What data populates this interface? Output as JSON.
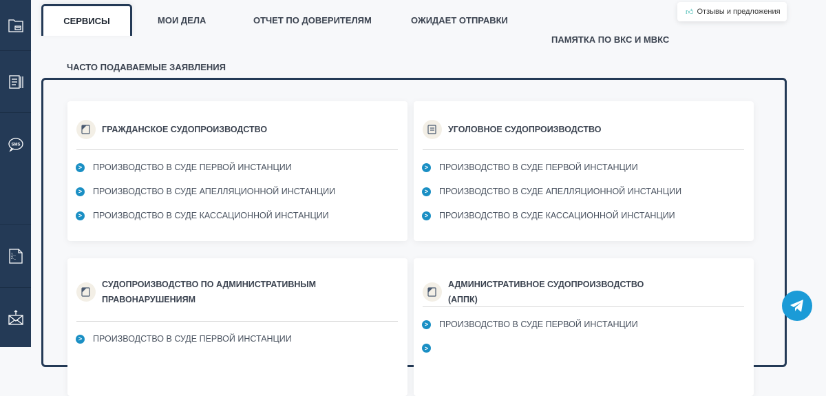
{
  "sidebar": {
    "items": [
      {
        "icon": "folder-icon"
      },
      {
        "icon": "documents-icon"
      },
      {
        "icon": "sms-icon"
      },
      {
        "icon": "numbered-list-icon"
      },
      {
        "icon": "mail-upload-icon"
      }
    ]
  },
  "tabs": [
    "СЕРВИСЫ",
    "МОИ ДЕЛА",
    "ОТЧЕТ ПО ДОВЕРИТЕЛЯМ",
    "ОЖИДАЕТ ОТПРАВКИ",
    "ПАМЯТКА ПО ВКС И МВКС"
  ],
  "subtab": "ЧАСТО ПОДАВАЕМЫЕ ЗАЯВЛЕНИЯ",
  "feedback": "Отзывы и предложения",
  "cards": [
    {
      "title": "ГРАЖДАНСКОЕ СУДОПРОИЗВОДСТВО",
      "items": [
        "ПРОИЗВОДСТВО В СУДЕ ПЕРВОЙ ИНСТАНЦИИ",
        "ПРОИЗВОДСТВО В СУДЕ АПЕЛЛЯЦИОННОЙ ИНСТАНЦИИ",
        "ПРОИЗВОДСТВО В СУДЕ КАССАЦИОННОЙ ИНСТАНЦИИ"
      ]
    },
    {
      "title": "УГОЛОВНОЕ СУДОПРОИЗВОДСТВО",
      "items": [
        "ПРОИЗВОДСТВО В СУДЕ ПЕРВОЙ ИНСТАНЦИИ",
        "ПРОИЗВОДСТВО В СУДЕ АПЕЛЛЯЦИОННОЙ ИНСТАНЦИИ",
        "ПРОИЗВОДСТВО В СУДЕ КАССАЦИОННОЙ ИНСТАНЦИИ"
      ]
    },
    {
      "title": "СУДОПРОИЗВОДСТВО ПО АДМИНИСТРАТИВНЫМ ПРАВОНАРУШЕНИЯМ",
      "items": [
        "ПРОИЗВОДСТВО В СУДЕ ПЕРВОЙ ИНСТАНЦИИ"
      ]
    },
    {
      "title": "АДМИНИСТРАТИВНОЕ СУДОПРОИЗВОДСТВО (АППК)",
      "items": [
        "ПРОИЗВОДСТВО В СУДЕ ПЕРВОЙ ИНСТАНЦИИ"
      ]
    }
  ]
}
